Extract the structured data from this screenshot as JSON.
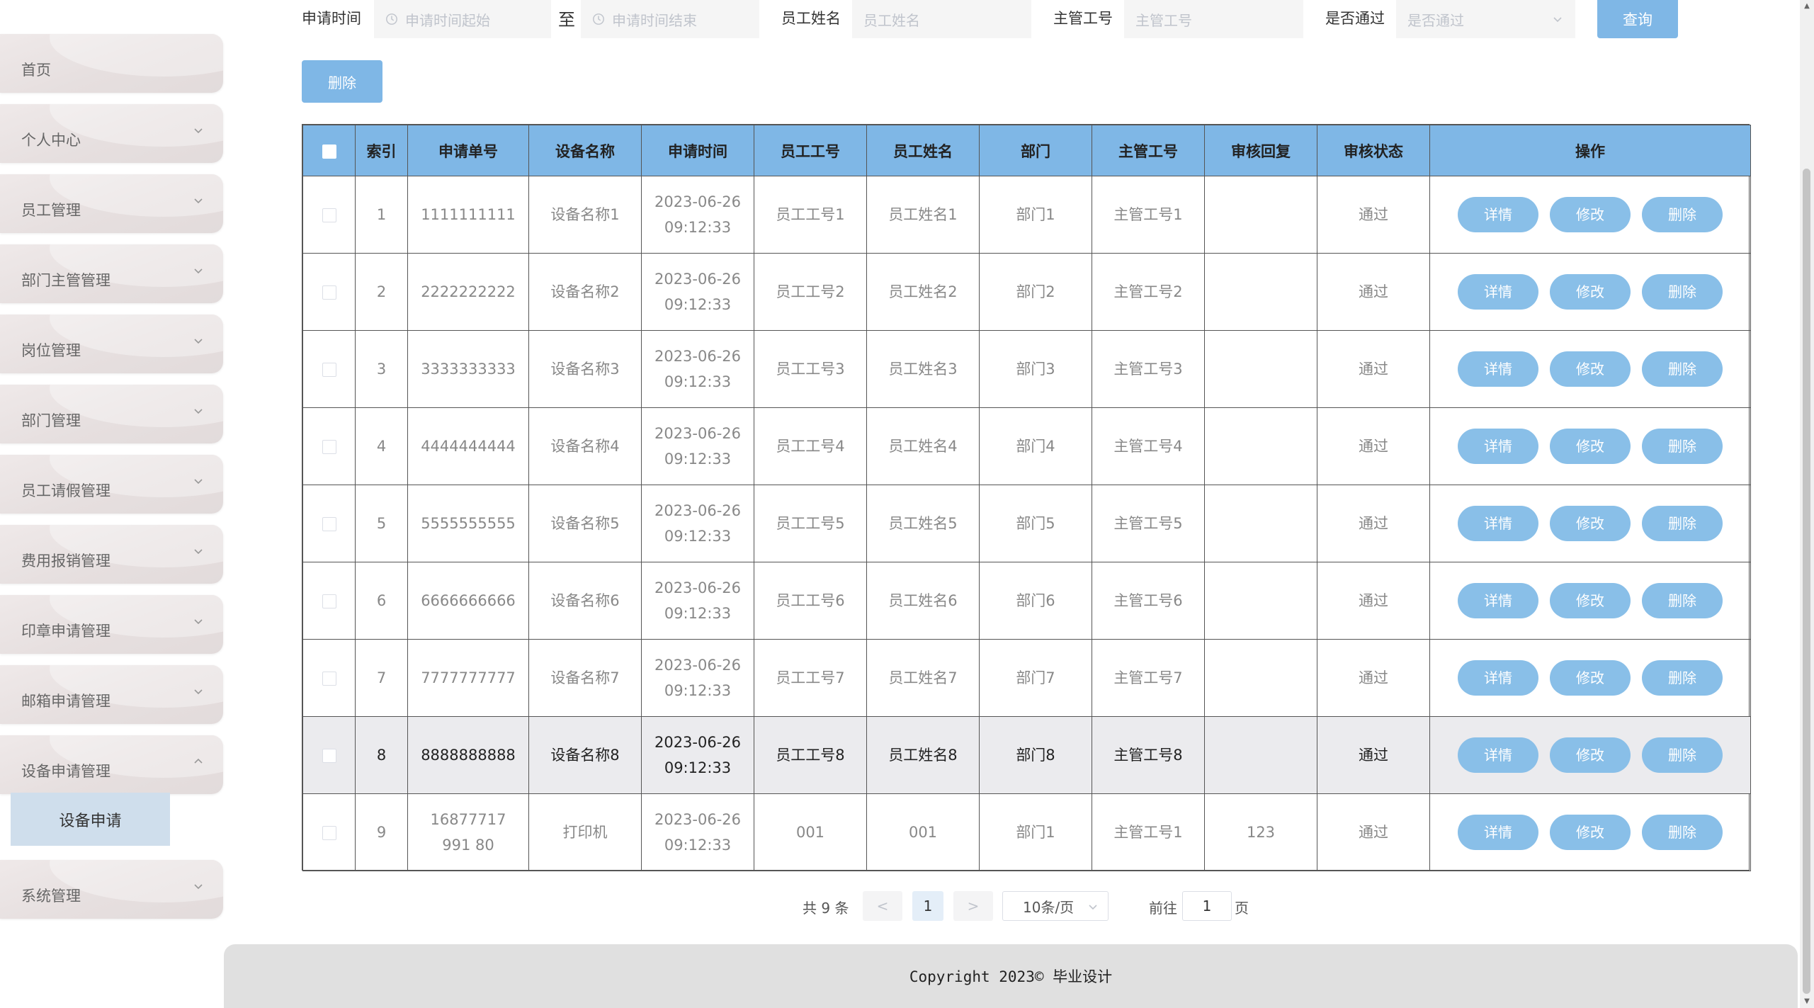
{
  "sidebar": {
    "items": [
      {
        "label": "首页",
        "has_chevron": false
      },
      {
        "label": "个人中心",
        "has_chevron": true
      },
      {
        "label": "员工管理",
        "has_chevron": true
      },
      {
        "label": "部门主管管理",
        "has_chevron": true
      },
      {
        "label": "岗位管理",
        "has_chevron": true
      },
      {
        "label": "部门管理",
        "has_chevron": true
      },
      {
        "label": "员工请假管理",
        "has_chevron": true
      },
      {
        "label": "费用报销管理",
        "has_chevron": true
      },
      {
        "label": "印章申请管理",
        "has_chevron": true
      },
      {
        "label": "邮箱申请管理",
        "has_chevron": true
      },
      {
        "label": "设备申请管理",
        "has_chevron": true,
        "expanded": true
      },
      {
        "label": "系统管理",
        "has_chevron": true
      }
    ],
    "submenu_active": "设备申请"
  },
  "search": {
    "apply_time_label": "申请时间",
    "start_placeholder": "申请时间起始",
    "range_separator": "至",
    "end_placeholder": "申请时间结束",
    "employee_name_label": "员工姓名",
    "employee_name_placeholder": "员工姓名",
    "manager_no_label": "主管工号",
    "manager_no_placeholder": "主管工号",
    "approved_label": "是否通过",
    "approved_placeholder": "是否通过",
    "query_button": "查询"
  },
  "toolbar": {
    "delete_button": "删除"
  },
  "table": {
    "headers": [
      "索引",
      "申请单号",
      "设备名称",
      "申请时间",
      "员工工号",
      "员工姓名",
      "部门",
      "主管工号",
      "审核回复",
      "审核状态",
      "操作"
    ],
    "rows": [
      {
        "index": "1",
        "no": "1111111111",
        "device": "设备名称1",
        "date": "2023-06-26",
        "time": "09:12:33",
        "emp_no": "员工工号1",
        "emp_name": "员工姓名1",
        "dept": "部门1",
        "mgr_no": "主管工号1",
        "reply": "",
        "status": "通过"
      },
      {
        "index": "2",
        "no": "2222222222",
        "device": "设备名称2",
        "date": "2023-06-26",
        "time": "09:12:33",
        "emp_no": "员工工号2",
        "emp_name": "员工姓名2",
        "dept": "部门2",
        "mgr_no": "主管工号2",
        "reply": "",
        "status": "通过"
      },
      {
        "index": "3",
        "no": "3333333333",
        "device": "设备名称3",
        "date": "2023-06-26",
        "time": "09:12:33",
        "emp_no": "员工工号3",
        "emp_name": "员工姓名3",
        "dept": "部门3",
        "mgr_no": "主管工号3",
        "reply": "",
        "status": "通过"
      },
      {
        "index": "4",
        "no": "4444444444",
        "device": "设备名称4",
        "date": "2023-06-26",
        "time": "09:12:33",
        "emp_no": "员工工号4",
        "emp_name": "员工姓名4",
        "dept": "部门4",
        "mgr_no": "主管工号4",
        "reply": "",
        "status": "通过"
      },
      {
        "index": "5",
        "no": "5555555555",
        "device": "设备名称5",
        "date": "2023-06-26",
        "time": "09:12:33",
        "emp_no": "员工工号5",
        "emp_name": "员工姓名5",
        "dept": "部门5",
        "mgr_no": "主管工号5",
        "reply": "",
        "status": "通过"
      },
      {
        "index": "6",
        "no": "6666666666",
        "device": "设备名称6",
        "date": "2023-06-26",
        "time": "09:12:33",
        "emp_no": "员工工号6",
        "emp_name": "员工姓名6",
        "dept": "部门6",
        "mgr_no": "主管工号6",
        "reply": "",
        "status": "通过"
      },
      {
        "index": "7",
        "no": "7777777777",
        "device": "设备名称7",
        "date": "2023-06-26",
        "time": "09:12:33",
        "emp_no": "员工工号7",
        "emp_name": "员工姓名7",
        "dept": "部门7",
        "mgr_no": "主管工号7",
        "reply": "",
        "status": "通过"
      },
      {
        "index": "8",
        "no": "8888888888",
        "device": "设备名称8",
        "date": "2023-06-26",
        "time": "09:12:33",
        "emp_no": "员工工号8",
        "emp_name": "员工姓名8",
        "dept": "部门8",
        "mgr_no": "主管工号8",
        "reply": "",
        "status": "通过",
        "highlighted": true
      },
      {
        "index": "9",
        "no": "16877717991 80",
        "device": "打印机",
        "date": "2023-06-26",
        "time": "09:12:33",
        "emp_no": "001",
        "emp_name": "001",
        "dept": "部门1",
        "mgr_no": "主管工号1",
        "reply": "123",
        "status": "通过"
      }
    ],
    "actions": {
      "detail": "详情",
      "edit": "修改",
      "delete": "删除"
    }
  },
  "pagination": {
    "total_text": "共 9 条",
    "prev": "<",
    "current_page": "1",
    "next": ">",
    "page_size": "10条/页",
    "goto_label": "前往",
    "goto_value": "1",
    "page_suffix": "页"
  },
  "footer": {
    "copyright": "Copyright 2023© 毕业设计"
  },
  "colors": {
    "accent": "#7fb7e6",
    "pill": "#89bfe8",
    "sidebar": "#e6dfdf",
    "active_submenu": "#cfdeec"
  }
}
